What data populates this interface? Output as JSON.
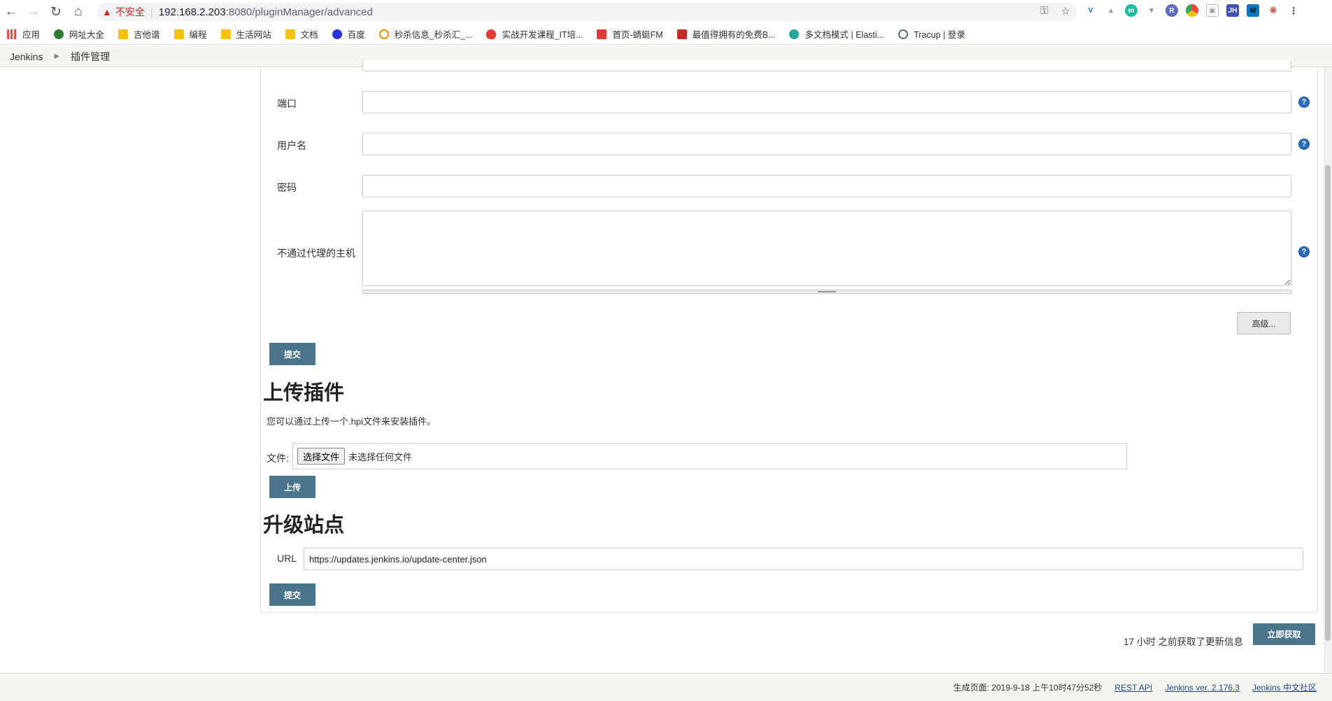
{
  "browser": {
    "security_label": "不安全",
    "url_host": "192.168.2.203",
    "url_rest": ":8080/pluginManager/advanced",
    "extension_icons": [
      "vue-devtools-icon",
      "extension-icon",
      "m-extension-icon",
      "filter-extension-icon",
      "r-extension-icon",
      "chrome-extension-icon",
      "screenshot-extension-icon",
      "jh-extension-icon",
      "m-box-extension-icon",
      "spider-extension-icon"
    ]
  },
  "bookmarks": [
    {
      "label": "应用",
      "color": "#e74c3c"
    },
    {
      "label": "网址大全",
      "color": "#2e7d32"
    },
    {
      "label": "吉他谱",
      "color": "#f4c20d"
    },
    {
      "label": "编程",
      "color": "#f4c20d"
    },
    {
      "label": "生活网站",
      "color": "#f4c20d"
    },
    {
      "label": "文档",
      "color": "#f4c20d"
    },
    {
      "label": "百度",
      "color": "#2932e1"
    },
    {
      "label": "秒杀信息_秒杀汇_...",
      "color": "#ff8a00"
    },
    {
      "label": "实战开发课程_IT培...",
      "color": "#e53935"
    },
    {
      "label": "首页-蜻蜓FM",
      "color": "#e53935"
    },
    {
      "label": "最值得拥有的免费B...",
      "color": "#c62828"
    },
    {
      "label": "多文档模式 | Elasti...",
      "color": "#26a69a"
    },
    {
      "label": "Tracup | 登录",
      "color": "#546e7a"
    }
  ],
  "breadcrumb": {
    "root": "Jenkins",
    "current": "插件管理"
  },
  "proxy_form": {
    "port_label": "端口",
    "username_label": "用户名",
    "password_label": "密码",
    "no_proxy_label": "不通过代理的主机",
    "advanced_button": "高级...",
    "submit_button": "提交"
  },
  "upload": {
    "title": "上传插件",
    "description": "您可以通过上传一个.hpi文件来安装插件。",
    "file_label": "文件:",
    "choose_button": "选择文件",
    "no_file_text": "未选择任何文件",
    "upload_button": "上传"
  },
  "update_site": {
    "title": "升级站点",
    "url_label": "URL",
    "url_value": "https://updates.jenkins.io/update-center.json",
    "submit_button": "提交"
  },
  "status": {
    "text": "17 小时 之前获取了更新信息",
    "check_now_button": "立即获取"
  },
  "footer": {
    "generated": "生成页面: 2019-9-18 上午10时47分52秒",
    "rest_api": "REST API",
    "version": "Jenkins ver. 2.176.3",
    "community": "Jenkins 中文社区"
  }
}
